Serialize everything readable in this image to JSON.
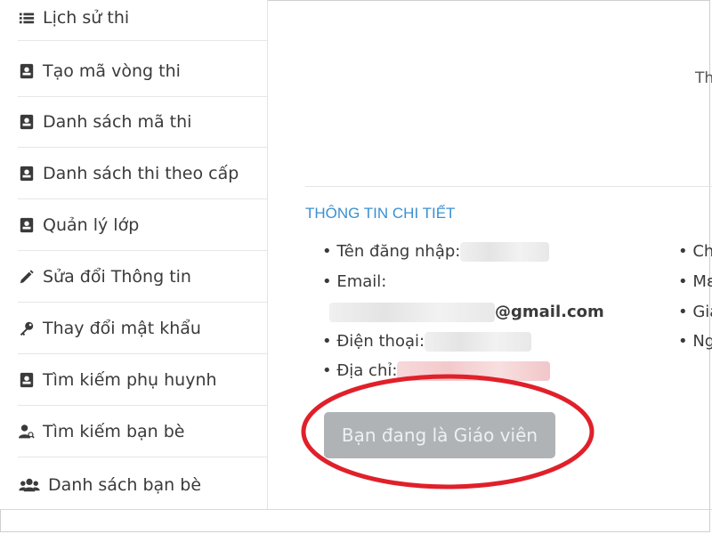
{
  "sidebar": {
    "items": [
      {
        "label": "Lịch sử thi",
        "icon": "list-icon"
      },
      {
        "label": "Tạo mã vòng thi",
        "icon": "contact-card-icon"
      },
      {
        "label": "Danh sách mã thi",
        "icon": "contact-card-icon"
      },
      {
        "label": "Danh sách thi theo cấp",
        "icon": "contact-card-icon"
      },
      {
        "label": "Quản lý lớp",
        "icon": "contact-card-icon"
      },
      {
        "label": "Sửa đổi Thông tin",
        "icon": "pencil-icon"
      },
      {
        "label": "Thay đổi mật khẩu",
        "icon": "key-icon"
      },
      {
        "label": "Tìm kiếm phụ huynh",
        "icon": "contact-card-icon"
      },
      {
        "label": "Tìm kiếm bạn bè",
        "icon": "user-search-icon"
      },
      {
        "label": "Danh sách bạn bè",
        "icon": "users-icon"
      }
    ]
  },
  "main": {
    "right_partial": "Th",
    "section_title": "THÔNG TIN CHI TIẾT",
    "fields": {
      "username_label": "Tên đăng nhập:",
      "email_label": "Email:",
      "email_domain": "@gmail.com",
      "phone_label": "Điện thoại:",
      "address_label": "Địa chỉ:"
    },
    "right_column": [
      "Ch",
      "Mε",
      "Gia",
      "Ng"
    ],
    "role_button": "Bạn đang là Giáo viên"
  },
  "colors": {
    "section_title": "#3b8fd1",
    "button_bg": "#b0b3b6",
    "highlight_ellipse": "#e0202a"
  }
}
